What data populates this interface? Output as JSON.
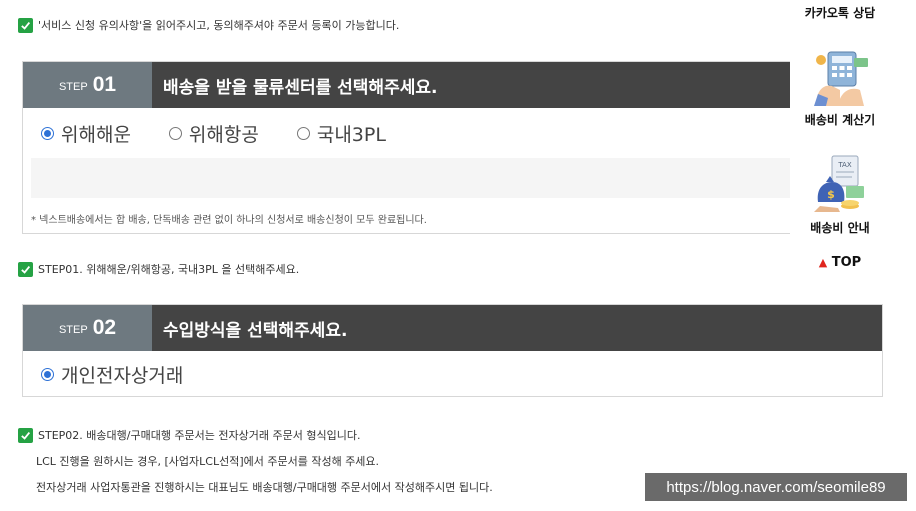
{
  "notices": {
    "top": "'서비스 신청 유의사항'을 읽어주시고, 동의해주셔야 주문서 등록이 가능합니다.",
    "step1": "STEP01. 위해해운/위해항공, 국내3PL 을 선택해주세요.",
    "step2_line1": "STEP02. 배송대행/구매대행 주문서는 전자상거래 주문서 형식입니다.",
    "step2_line2": "LCL 진행을 원하시는 경우, [사업자LCL선적]에서 주문서를 작성해 주세요.",
    "step2_line3": "전자상거래 사업자통관을 진행하시는 대표님도 배송대행/구매대행 주문서에서 작성해주시면 됩니다."
  },
  "step1": {
    "step_word": "STEP",
    "step_num": "01",
    "title": "배송을 받을 물류센터를 선택해주세요.",
    "options": [
      {
        "label": "위해해운",
        "selected": true
      },
      {
        "label": "위해항공",
        "selected": false
      },
      {
        "label": "국내3PL",
        "selected": false
      }
    ],
    "note": "* 넥스트배송에서는 합 배송, 단독배송 관련 없이 하나의 신청서로 배송신청이 모두 완료됩니다."
  },
  "step2": {
    "step_word": "STEP",
    "step_num": "02",
    "title": "수입방식을 선택해주세요.",
    "options": [
      {
        "label": "개인전자상거래",
        "selected": true
      }
    ]
  },
  "sidebar": {
    "kakao": "카카오톡 상담",
    "calc": "배송비 계산기",
    "guide": "배송비 안내",
    "top": "TOP",
    "tax_label": "TAX"
  },
  "watermark": "https://blog.naver.com/seomile89",
  "colors": {
    "check_green": "#25a244",
    "step_num_bg": "#6e7980",
    "step_head_bg": "#444444",
    "radio_blue": "#2d71d6",
    "top_arrow": "#e0261e"
  }
}
